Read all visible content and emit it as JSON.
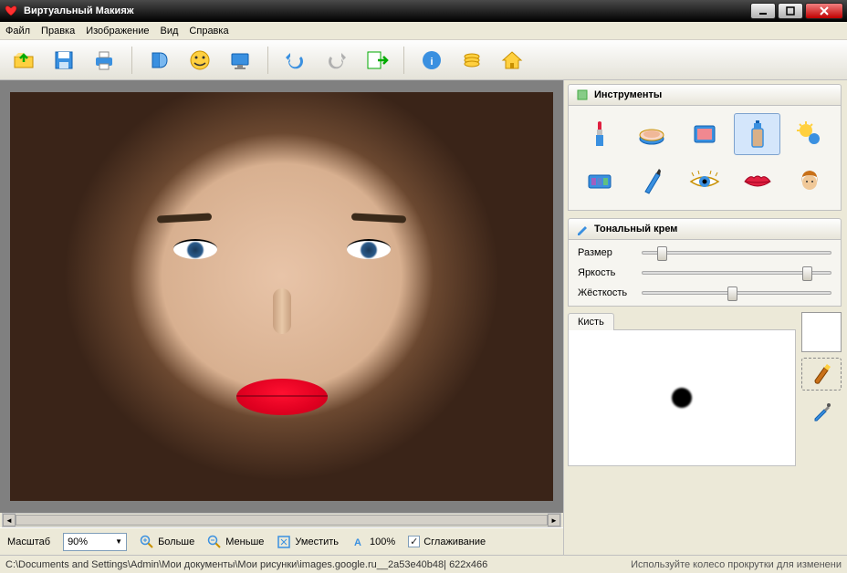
{
  "window": {
    "title": "Виртуальный Макияж"
  },
  "menu": {
    "file": "Файл",
    "edit": "Правка",
    "image": "Изображение",
    "view": "Вид",
    "help": "Справка"
  },
  "zoombar": {
    "scale_label": "Масштаб",
    "scale_value": "90%",
    "bigger": "Больше",
    "smaller": "Меньше",
    "fit": "Уместить",
    "hundred": "100%",
    "smoothing": "Сглаживание",
    "smoothing_checked": "✓"
  },
  "panels": {
    "tools_title": "Инструменты",
    "current_tool_title": "Тональный крем",
    "sliders": {
      "size": "Размер",
      "brightness": "Яркость",
      "hardness": "Жёсткость"
    },
    "slider_values": {
      "size": 8,
      "brightness": 85,
      "hardness": 45
    },
    "brush_tab": "Кисть"
  },
  "status": {
    "path": "C:\\Documents and Settings\\Admin\\Мои документы\\Мои рисунки\\images.google.ru__2a53e40b48| 622x466",
    "hint": "Используйте колесо прокрутки для изменени"
  },
  "tools": {
    "lipstick": "lipstick",
    "powder": "powder",
    "blush": "blush",
    "foundation": "foundation",
    "tan": "tan",
    "eyeshadow": "eyeshadow",
    "eyeliner": "eyeliner",
    "eyecolor": "eyecolor",
    "lips": "lips",
    "hair": "hair"
  }
}
